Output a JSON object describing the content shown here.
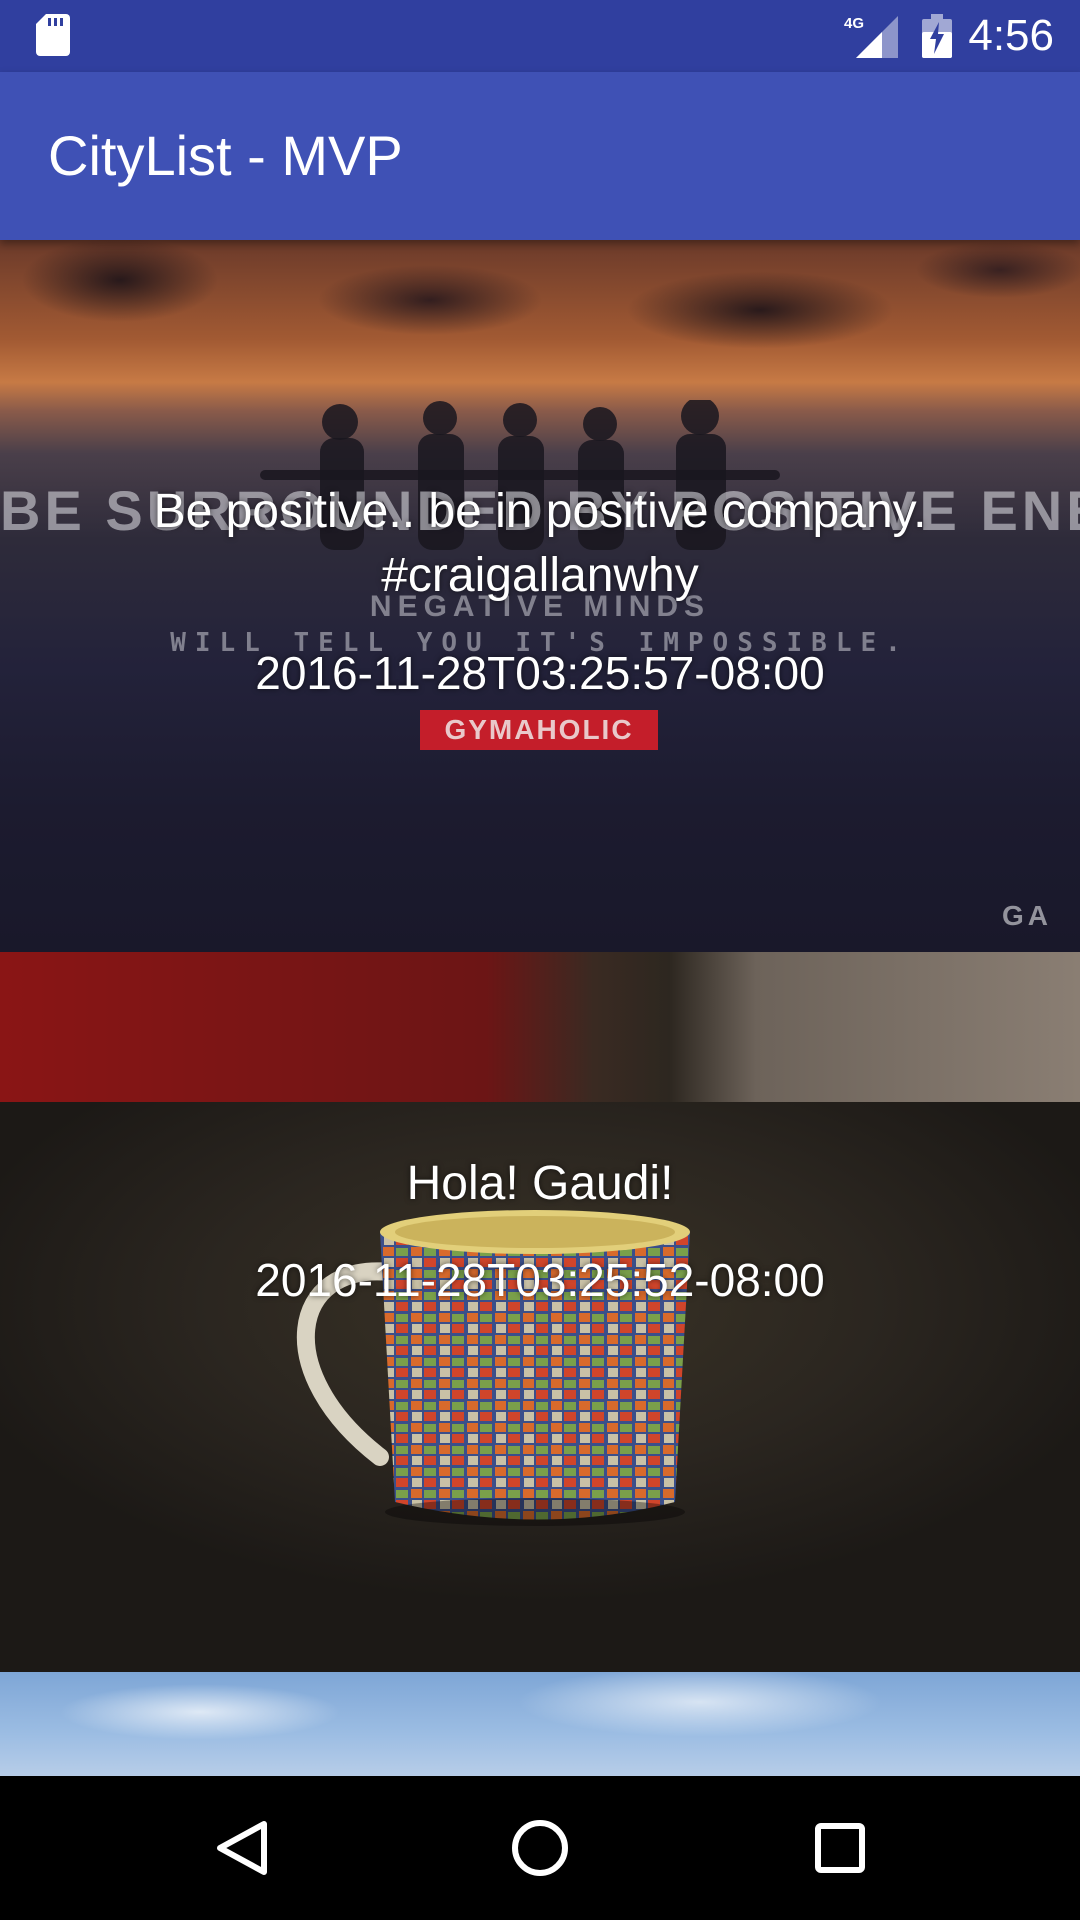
{
  "status_bar": {
    "time": "4:56",
    "network_label": "4G",
    "icons": [
      "sd-card-icon",
      "signal-icon",
      "battery-charging-icon"
    ],
    "color": "#303f9f"
  },
  "app_bar": {
    "title": "CityList - MVP",
    "color": "#3f51b5"
  },
  "feed": {
    "items": [
      {
        "title": "Be positive.. be in positive company. #craigallanwhy",
        "date": "2016-11-28T03:25:57-08:00",
        "poster_text": {
          "headline": "BE SURROUNDED BY POSITIVE ENERGY",
          "line_2": "NEGATIVE MINDS",
          "line_3": "WILL TELL YOU IT'S IMPOSSIBLE.",
          "badge": "GYMAHOLIC",
          "mark": "GA"
        }
      },
      {
        "title": "Hola! Gaudi!",
        "date": "2016-11-28T03:25:52-08:00"
      }
    ]
  },
  "nav_bar": {
    "buttons": [
      "back-icon",
      "home-icon",
      "recents-icon"
    ]
  }
}
